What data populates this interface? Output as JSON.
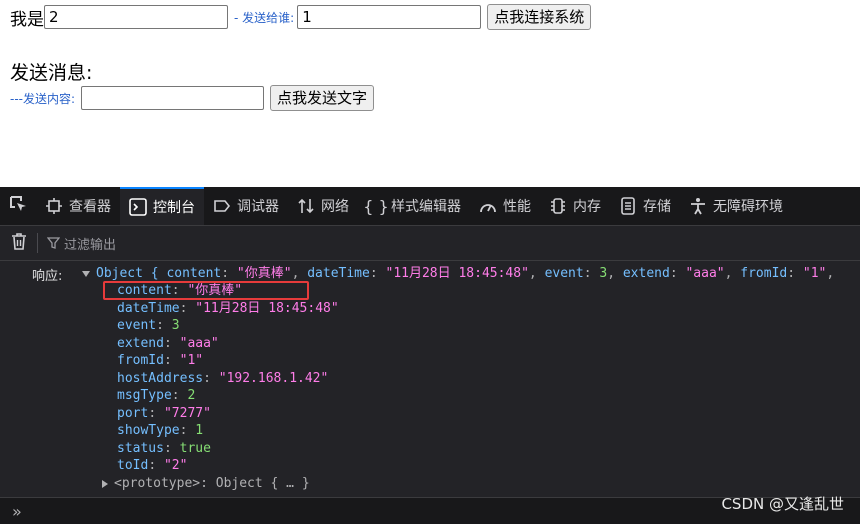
{
  "form": {
    "me_label": "我是",
    "me_value": "2",
    "sendto_label": "- 发送给谁:",
    "sendto_value": "1",
    "connect_button": "点我连接系统",
    "send_heading": "发送消息:",
    "content_label": "---发送内容:",
    "content_value": "",
    "send_button": "点我发送文字"
  },
  "devtools": {
    "tabs": [
      {
        "label": "查看器",
        "icon": "inspector-icon"
      },
      {
        "label": "控制台",
        "icon": "console-icon",
        "active": true
      },
      {
        "label": "调试器",
        "icon": "debugger-icon"
      },
      {
        "label": "网络",
        "icon": "network-icon"
      },
      {
        "label": "样式编辑器",
        "icon": "style-editor-icon"
      },
      {
        "label": "性能",
        "icon": "performance-icon"
      },
      {
        "label": "内存",
        "icon": "memory-icon"
      },
      {
        "label": "存储",
        "icon": "storage-icon"
      },
      {
        "label": "无障碍环境",
        "icon": "accessibility-icon"
      }
    ],
    "filter_placeholder": "过滤输出",
    "accent": "#0a84ff"
  },
  "console": {
    "prefix": "响应:",
    "summary": {
      "head": "Object { ",
      "content_key": "content",
      "content_val": "\"你真棒\"",
      "datetime_key": "dateTime",
      "datetime_val": "\"11月28日 18:45:48\"",
      "event_key": "event",
      "event_val": "3",
      "extend_key": "extend",
      "extend_val": "\"aaa\"",
      "fromid_key": "fromId",
      "fromid_val": "\"1\"",
      "tail": ","
    },
    "props": [
      {
        "key": "content",
        "value": "\"你真棒\"",
        "type": "s"
      },
      {
        "key": "dateTime",
        "value": "\"11月28日 18:45:48\"",
        "type": "s"
      },
      {
        "key": "event",
        "value": "3",
        "type": "n"
      },
      {
        "key": "extend",
        "value": "\"aaa\"",
        "type": "s"
      },
      {
        "key": "fromId",
        "value": "\"1\"",
        "type": "s"
      },
      {
        "key": "hostAddress",
        "value": "\"192.168.1.42\"",
        "type": "s"
      },
      {
        "key": "msgType",
        "value": "2",
        "type": "n"
      },
      {
        "key": "port",
        "value": "\"7277\"",
        "type": "s"
      },
      {
        "key": "showType",
        "value": "1",
        "type": "n"
      },
      {
        "key": "status",
        "value": "true",
        "type": "b"
      },
      {
        "key": "toId",
        "value": "\"2\"",
        "type": "s"
      }
    ],
    "prototype": "<prototype>: Object { … }"
  },
  "bottom": {
    "prompt": "»",
    "watermark": "CSDN @又逢乱世"
  }
}
